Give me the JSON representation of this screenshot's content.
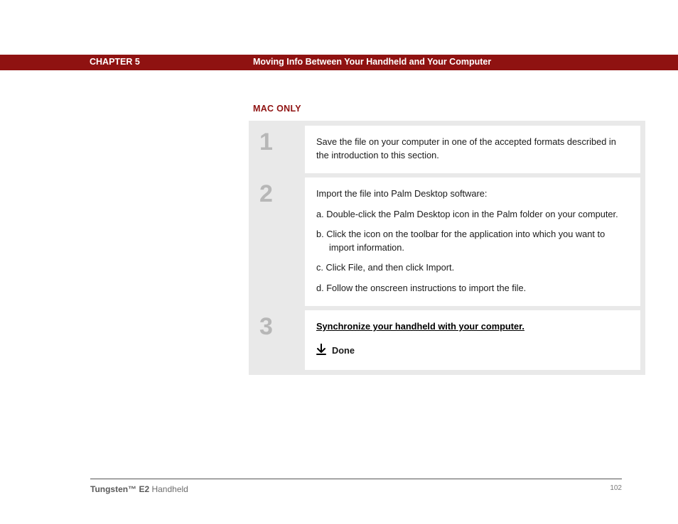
{
  "header": {
    "chapter": "CHAPTER 5",
    "title": "Moving Info Between Your Handheld and Your Computer"
  },
  "section_label": "MAC ONLY",
  "steps": [
    {
      "num": "1",
      "body": "Save the file on your computer in one of the accepted formats described in the introduction to this section."
    },
    {
      "num": "2",
      "lead": "Import the file into Palm Desktop software:",
      "subs": [
        "a.  Double-click the Palm Desktop icon in the Palm folder on your computer.",
        "b.  Click the icon on the toolbar for the application into which you want to import information.",
        "c.  Click File, and then click Import.",
        "d.  Follow the onscreen instructions to import the file."
      ]
    },
    {
      "num": "3",
      "link": "Synchronize your handheld with your computer.",
      "done": "Done"
    }
  ],
  "footer": {
    "product_bold": "Tungsten™ E2",
    "product_rest": " Handheld",
    "page": "102"
  }
}
